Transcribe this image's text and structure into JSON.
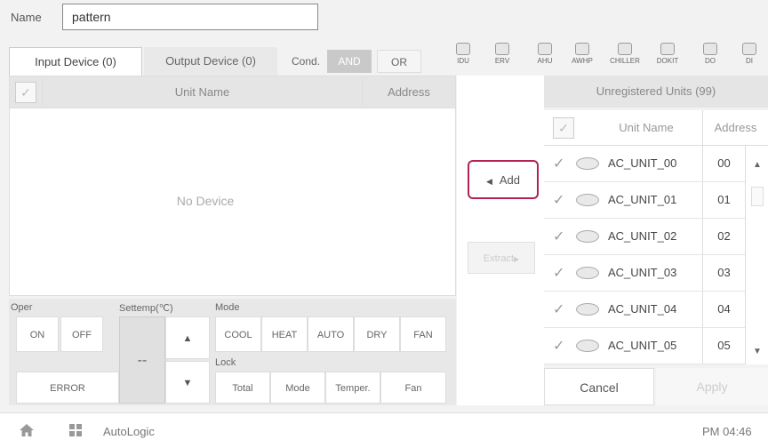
{
  "name_field": {
    "label": "Name",
    "value": "pattern"
  },
  "tabs": {
    "input": "Input Device (0)",
    "output": "Output Device (0)"
  },
  "cond": {
    "label": "Cond.",
    "and": "AND",
    "or": "OR",
    "selected": "AND"
  },
  "device_types": [
    {
      "label": "IDU",
      "icon": "idu-icon"
    },
    {
      "label": "ERV",
      "icon": "erv-icon"
    },
    {
      "label": "AHU",
      "icon": "ahu-icon"
    },
    {
      "label": "AWHP",
      "icon": "awhp-icon"
    },
    {
      "label": "CHILLER",
      "icon": "chiller-icon"
    },
    {
      "label": "DOKIT",
      "icon": "dokit-icon"
    },
    {
      "label": "DO",
      "icon": "do-icon"
    },
    {
      "label": "DI",
      "icon": "di-icon"
    }
  ],
  "left_table": {
    "col_unit": "Unit Name",
    "col_address": "Address",
    "empty_text": "No Device"
  },
  "controls": {
    "oper_label": "Oper",
    "on": "ON",
    "off": "OFF",
    "error": "ERROR",
    "settemp_label": "Settemp(℃)",
    "settemp_value": "--",
    "mode_label": "Mode",
    "modes": [
      "COOL",
      "HEAT",
      "AUTO",
      "DRY",
      "FAN"
    ],
    "lock_label": "Lock",
    "locks": [
      "Total",
      "Mode",
      "Temper.",
      "Fan"
    ]
  },
  "add_label": "Add",
  "extract_label": "Extract",
  "right_panel": {
    "title": "Unregistered Units (99)",
    "col_unit": "Unit Name",
    "col_address": "Address",
    "units": [
      {
        "name": "AC_UNIT_00",
        "address": "00"
      },
      {
        "name": "AC_UNIT_01",
        "address": "01"
      },
      {
        "name": "AC_UNIT_02",
        "address": "02"
      },
      {
        "name": "AC_UNIT_03",
        "address": "03"
      },
      {
        "name": "AC_UNIT_04",
        "address": "04"
      },
      {
        "name": "AC_UNIT_05",
        "address": "05"
      }
    ],
    "cancel": "Cancel",
    "apply": "Apply"
  },
  "bottom_bar": {
    "app_name": "AutoLogic",
    "time": "PM 04:46"
  },
  "colors": {
    "accent": "#b32454"
  }
}
